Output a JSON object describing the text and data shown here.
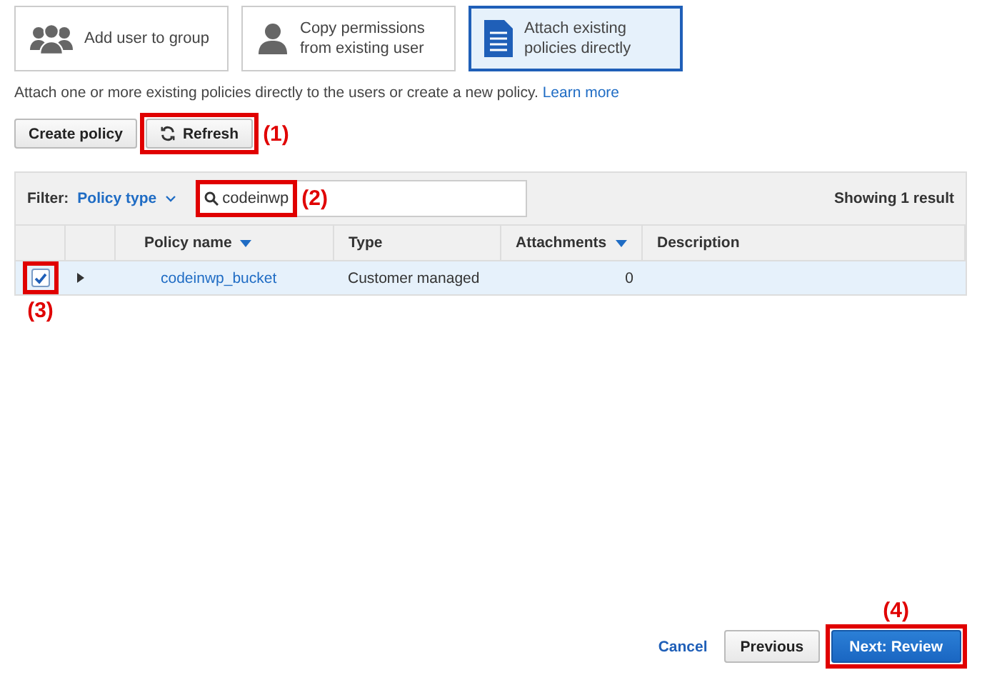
{
  "options": [
    {
      "kind": "group",
      "label": "Add user to group",
      "selected": false
    },
    {
      "kind": "user",
      "label": "Copy permissions from existing user",
      "selected": false
    },
    {
      "kind": "document",
      "label": "Attach existing policies directly",
      "selected": true
    }
  ],
  "description": {
    "text": "Attach one or more existing policies directly to the users or create a new policy.",
    "link": "Learn more"
  },
  "toolbar": [
    {
      "kind": "plain",
      "label": "Create policy"
    },
    {
      "kind": "refresh",
      "label": "Refresh",
      "annotation": {
        "label": "(1)",
        "kind": "right"
      }
    }
  ],
  "filter": {
    "label": "Filter:",
    "value": "Policy type",
    "search_value": "codeinwp",
    "annotation": {
      "label": "(2)",
      "kind": "right"
    },
    "result_count": "Showing 1 result"
  },
  "table": {
    "columns": [
      {
        "label": "Policy name",
        "sorted": true
      },
      {
        "label": "Type",
        "sorted": false
      },
      {
        "label": "Attachments",
        "sorted": true
      },
      {
        "label": "Description",
        "sorted": false
      }
    ],
    "rows": [
      {
        "checked": true,
        "selected": true,
        "expanded": false,
        "name": "codeinwp_bucket",
        "type": "Customer managed",
        "attachments": "0",
        "annotation": {
          "label": "(3)",
          "kind": "below"
        }
      }
    ]
  },
  "footer": {
    "cancel": "Cancel",
    "previous": "Previous",
    "next": "Next: Review",
    "annotation": {
      "label": "(4)",
      "kind": "above"
    }
  }
}
